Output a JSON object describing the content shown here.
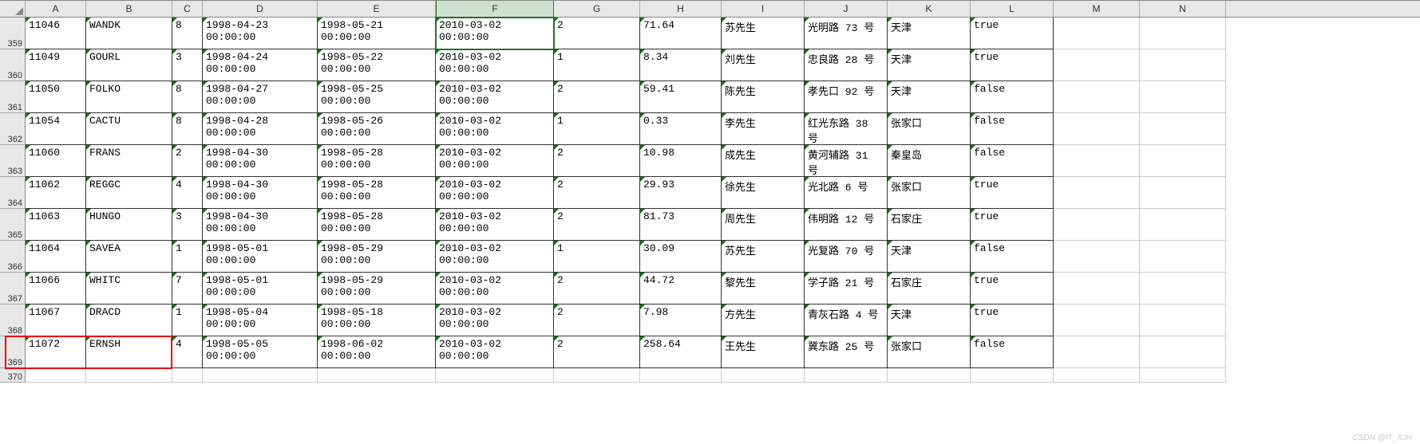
{
  "columns": [
    "A",
    "B",
    "C",
    "D",
    "E",
    "F",
    "G",
    "H",
    "I",
    "J",
    "K",
    "L",
    "M",
    "N"
  ],
  "selected_column": "F",
  "highlight_row_index": 10,
  "watermark": "CSDN @IT_XJH",
  "rows": [
    {
      "num": "359",
      "cells": [
        "11046",
        "WANDK",
        "8",
        "1998-04-23 00:00:00",
        "1998-05-21 00:00:00",
        "2010-03-02 00:00:00",
        "2",
        "71.64",
        "苏先生",
        "光明路 73 号",
        "天津",
        "true",
        "",
        ""
      ]
    },
    {
      "num": "360",
      "cells": [
        "11049",
        "GOURL",
        "3",
        "1998-04-24 00:00:00",
        "1998-05-22 00:00:00",
        "2010-03-02 00:00:00",
        "1",
        "8.34",
        "刘先生",
        "忠良路 28 号",
        "天津",
        "true",
        "",
        ""
      ]
    },
    {
      "num": "361",
      "cells": [
        "11050",
        "FOLKO",
        "8",
        "1998-04-27 00:00:00",
        "1998-05-25 00:00:00",
        "2010-03-02 00:00:00",
        "2",
        "59.41",
        "陈先生",
        "孝先口 92 号",
        "天津",
        "false",
        "",
        ""
      ]
    },
    {
      "num": "362",
      "cells": [
        "11054",
        "CACTU",
        "8",
        "1998-04-28 00:00:00",
        "1998-05-26 00:00:00",
        "2010-03-02 00:00:00",
        "1",
        "0.33",
        "李先生",
        "红光东路 38 号",
        "张家口",
        "false",
        "",
        ""
      ]
    },
    {
      "num": "363",
      "cells": [
        "11060",
        "FRANS",
        "2",
        "1998-04-30 00:00:00",
        "1998-05-28 00:00:00",
        "2010-03-02 00:00:00",
        "2",
        "10.98",
        "成先生",
        "黄河辅路 31 号",
        "秦皇岛",
        "false",
        "",
        ""
      ]
    },
    {
      "num": "364",
      "cells": [
        "11062",
        "REGGC",
        "4",
        "1998-04-30 00:00:00",
        "1998-05-28 00:00:00",
        "2010-03-02 00:00:00",
        "2",
        "29.93",
        "徐先生",
        "光北路 6 号",
        "张家口",
        "true",
        "",
        ""
      ]
    },
    {
      "num": "365",
      "cells": [
        "11063",
        "HUNGO",
        "3",
        "1998-04-30 00:00:00",
        "1998-05-28 00:00:00",
        "2010-03-02 00:00:00",
        "2",
        "81.73",
        "周先生",
        "伟明路 12 号",
        "石家庄",
        "true",
        "",
        ""
      ]
    },
    {
      "num": "366",
      "cells": [
        "11064",
        "SAVEA",
        "1",
        "1998-05-01 00:00:00",
        "1998-05-29 00:00:00",
        "2010-03-02 00:00:00",
        "1",
        "30.09",
        "苏先生",
        "光复路 70 号",
        "天津",
        "false",
        "",
        ""
      ]
    },
    {
      "num": "367",
      "cells": [
        "11066",
        "WHITC",
        "7",
        "1998-05-01 00:00:00",
        "1998-05-29 00:00:00",
        "2010-03-02 00:00:00",
        "2",
        "44.72",
        "黎先生",
        "学子路 21 号",
        "石家庄",
        "true",
        "",
        ""
      ]
    },
    {
      "num": "368",
      "cells": [
        "11067",
        "DRACD",
        "1",
        "1998-05-04 00:00:00",
        "1998-05-18 00:00:00",
        "2010-03-02 00:00:00",
        "2",
        "7.98",
        "方先生",
        "青灰石路 4 号",
        "天津",
        "true",
        "",
        ""
      ]
    },
    {
      "num": "369",
      "cells": [
        "11072",
        "ERNSH",
        "4",
        "1998-05-05 00:00:00",
        "1998-06-02 00:00:00",
        "2010-03-02 00:00:00",
        "2",
        "258.64",
        "王先生",
        "冀东路 25 号",
        "张家口",
        "false",
        "",
        ""
      ]
    },
    {
      "num": "370",
      "cells": [
        "",
        "",
        "",
        "",
        "",
        "",
        "",
        "",
        "",
        "",
        "",
        "",
        "",
        ""
      ],
      "short": true
    }
  ]
}
